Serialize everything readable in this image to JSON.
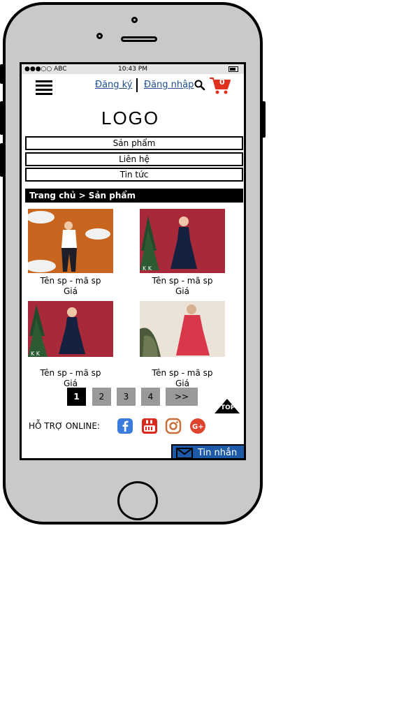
{
  "status_bar": {
    "carrier": "●●●○○ ABC",
    "time": "10:43 PM"
  },
  "header": {
    "register_label": "Đăng ký",
    "login_label": "Đăng nhập",
    "cart_count": "0",
    "logo": "LOGO"
  },
  "menu": {
    "items": [
      {
        "label": "Sản phẩm"
      },
      {
        "label": "Liên hệ"
      },
      {
        "label": "Tin tức"
      }
    ]
  },
  "breadcrumb": "Trang chủ > Sản phẩm",
  "products": [
    {
      "name": "Tên sp - mã sp",
      "price": "Giá"
    },
    {
      "name": "Tên sp - mã sp",
      "price": "Giá"
    },
    {
      "name": "Tên sp - mã sp",
      "price": "Giá"
    },
    {
      "name": "Tên sp - mã sp",
      "price": "Giá"
    }
  ],
  "pagination": {
    "pages": [
      "1",
      "2",
      "3",
      "4",
      ">>"
    ],
    "active": "1"
  },
  "scroll_top_label": "TOP",
  "support": {
    "label": "HỖ TRỢ ONLINE:"
  },
  "chat": {
    "label": "Tin nhắn"
  },
  "colors": {
    "link": "#1d4f91",
    "cart": "#e0301e",
    "chat": "#1d5aa8",
    "facebook": "#3b7ddd",
    "youtube": "#d9281e",
    "instagram": "#c7703a",
    "google_plus": "#e0442f"
  }
}
